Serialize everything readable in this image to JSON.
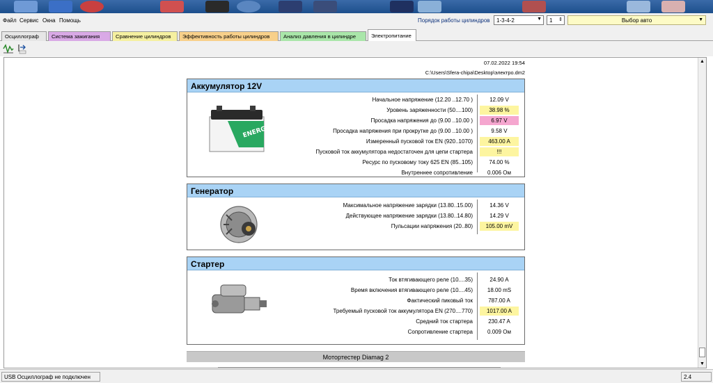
{
  "menu": {
    "items": [
      "Файл",
      "Сервис",
      "Окна",
      "Помощь"
    ]
  },
  "cylinders": {
    "label": "Порядок работы цилиндров",
    "order": "1-3-4-2",
    "count": "1"
  },
  "auto_select": {
    "label": "Выбор авто"
  },
  "tabs": [
    "Осциллограф",
    "Система зажигания",
    "Сравнение цилиндров",
    "Эффективность работы цилиндров",
    "Анализ давления в цилиндре",
    "Электропитание"
  ],
  "tab_colors": [
    "#e6e6e6",
    "#d9a9e6",
    "#f5f0a0",
    "#f8d08a",
    "#a9e6a9",
    "#ffffff"
  ],
  "report": {
    "date": "07.02.2022 19:54",
    "path": "C:\\Users\\Sfera-chipa\\Desktop\\электро.dm2"
  },
  "battery": {
    "title": "Аккумулятор 12V",
    "rows": [
      {
        "label": "Начальное напряжение (12.20 ..12.70 )",
        "value": "12.09 V",
        "hl": ""
      },
      {
        "label": "Уровень заряженности (50....100)",
        "value": "38.98 %",
        "hl": "yellow"
      },
      {
        "label": "Просадка напряжения до (9.00 ..10.00 )",
        "value": "6.97 V",
        "hl": "pink"
      },
      {
        "label": "Просадка напряжения при прокрутке до (9.00 ..10.00 )",
        "value": "9.58 V",
        "hl": ""
      },
      {
        "label": "Измеренный пусковой ток  EN (920..1070)",
        "value": "463.00 A",
        "hl": "yellow"
      },
      {
        "label": "Пусковой ток аккумулятора недостаточен для цепи стартера",
        "value": "!!!",
        "hl": "yellow"
      },
      {
        "label": "Ресурс по пусковому току  625 EN (85..105)",
        "value": "74.00 %",
        "hl": ""
      },
      {
        "label": "Внутреннее сопротивление",
        "value": "0.006 Ом",
        "hl": ""
      }
    ],
    "image_text": "ENERGY"
  },
  "generator": {
    "title": "Генератор",
    "rows": [
      {
        "label": "Максимальное напряжение зарядки  (13.80..15.00)",
        "value": "14.36 V",
        "hl": ""
      },
      {
        "label": "Действующее напряжение зарядки (13.80..14.80)",
        "value": "14.29 V",
        "hl": ""
      },
      {
        "label": "Пульсации напряжения (20..80)",
        "value": "105.00 mV",
        "hl": "yellow"
      }
    ]
  },
  "starter": {
    "title": "Стартер",
    "rows": [
      {
        "label": "Ток втягивающего реле (10....35)",
        "value": "24.90 A",
        "hl": ""
      },
      {
        "label": "Время включения втягивающего реле (10....45)",
        "value": "18.00 mS",
        "hl": ""
      },
      {
        "label": "Фактический пиковый ток",
        "value": "787.00 A",
        "hl": ""
      },
      {
        "label": "Требуемый пусковой ток аккумулятора  EN (270....770)",
        "value": "1017.00 A",
        "hl": "yellow"
      },
      {
        "label": "Средний ток стартера",
        "value": "230.47 A",
        "hl": ""
      },
      {
        "label": "Сопротивление стартера",
        "value": "0.009 Ом",
        "hl": ""
      }
    ]
  },
  "footer": {
    "text": "Мотортестер Diamag 2"
  },
  "status": {
    "left": "USB Осциллограф не подключен",
    "right": "2.4"
  },
  "colors": {
    "section_header": "#a9d3f5",
    "warning": "#fdf5a0",
    "error": "#f5a6cf"
  },
  "icons": {
    "tool1": "waveform-icon",
    "tool2": "export-icon"
  }
}
